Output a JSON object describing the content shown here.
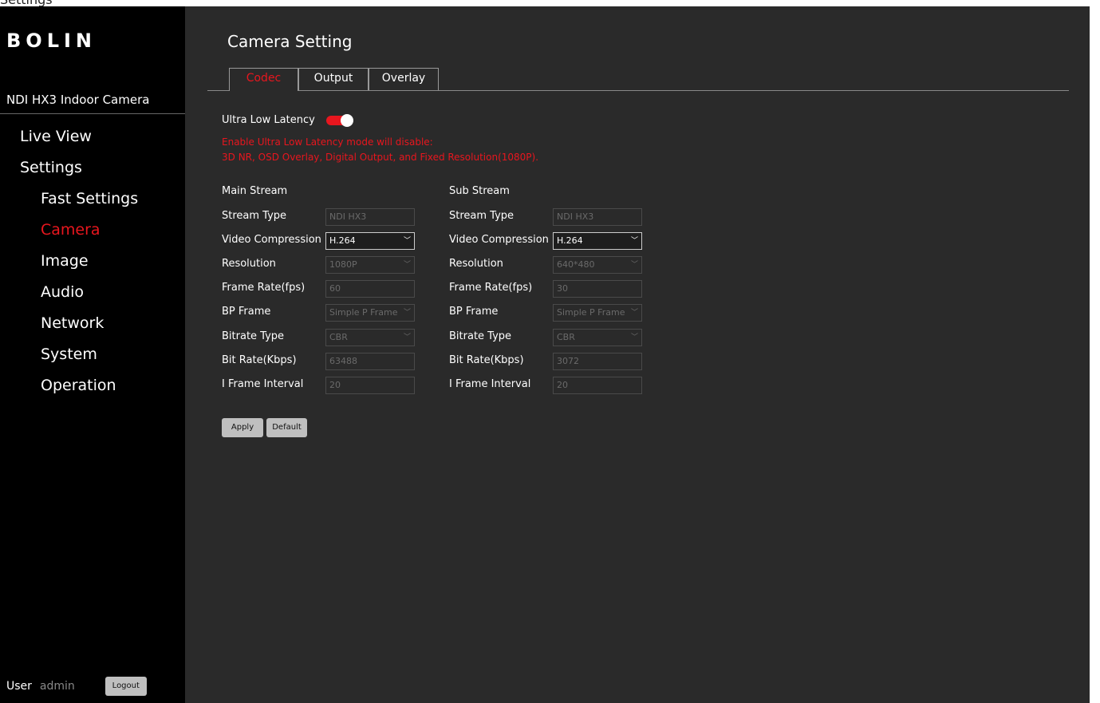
{
  "page_caption": "Settings",
  "sidebar": {
    "logo": "BOLIN",
    "device_name": "NDI HX3 Indoor Camera",
    "items": [
      {
        "label": "Live View"
      },
      {
        "label": "Settings"
      },
      {
        "label": "Fast Settings"
      },
      {
        "label": "Camera",
        "active": true
      },
      {
        "label": "Image"
      },
      {
        "label": "Audio"
      },
      {
        "label": "Network"
      },
      {
        "label": "System"
      },
      {
        "label": "Operation"
      }
    ],
    "user_label": "User",
    "user_name": "admin",
    "logout_label": "Logout"
  },
  "main": {
    "title": "Camera Setting",
    "tabs": [
      {
        "label": "Codec",
        "active": true
      },
      {
        "label": "Output"
      },
      {
        "label": "Overlay"
      }
    ],
    "ultra_low_latency": {
      "label": "Ultra Low Latency",
      "enabled": true,
      "warning_line1": "Enable Ultra Low Latency mode will disable:",
      "warning_line2": "3D NR, OSD Overlay, Digital Output, and Fixed Resolution(1080P)."
    },
    "main_stream": {
      "title": "Main Stream",
      "stream_type_label": "Stream Type",
      "stream_type": "NDI HX3",
      "video_compression_label": "Video Compression",
      "video_compression": "H.264",
      "resolution_label": "Resolution",
      "resolution": "1080P",
      "frame_rate_label": "Frame Rate(fps)",
      "frame_rate": "60",
      "bp_frame_label": "BP Frame",
      "bp_frame": "Simple P Frame",
      "bitrate_type_label": "Bitrate Type",
      "bitrate_type": "CBR",
      "bit_rate_label": "Bit Rate(Kbps)",
      "bit_rate": "63488",
      "i_frame_label": "I Frame Interval",
      "i_frame": "20"
    },
    "sub_stream": {
      "title": "Sub Stream",
      "stream_type_label": "Stream Type",
      "stream_type": "NDI HX3",
      "video_compression_label": "Video Compression",
      "video_compression": "H.264",
      "resolution_label": "Resolution",
      "resolution": "640*480",
      "frame_rate_label": "Frame Rate(fps)",
      "frame_rate": "30",
      "bp_frame_label": "BP Frame",
      "bp_frame": "Simple P Frame",
      "bitrate_type_label": "Bitrate Type",
      "bitrate_type": "CBR",
      "bit_rate_label": "Bit Rate(Kbps)",
      "bit_rate": "3072",
      "i_frame_label": "I Frame Interval",
      "i_frame": "20"
    },
    "apply_label": "Apply",
    "default_label": "Default"
  },
  "colors": {
    "accent": "#e8161e",
    "background": "#2a2a2a",
    "sidebar": "#000000"
  }
}
